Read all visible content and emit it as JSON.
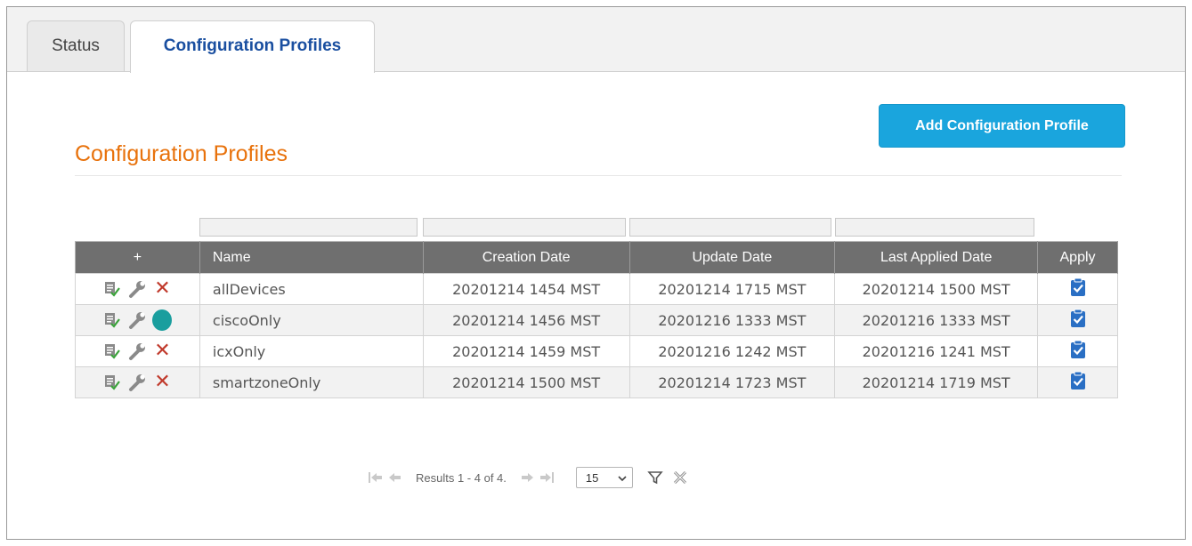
{
  "tabs": [
    {
      "label": "Status"
    },
    {
      "label": "Configuration Profiles"
    }
  ],
  "section": {
    "title": "Configuration Profiles",
    "add_button": "Add Configuration Profile"
  },
  "table": {
    "headers": {
      "actions": "+",
      "name": "Name",
      "creation": "Creation Date",
      "update": "Update Date",
      "last_applied": "Last Applied Date",
      "apply": "Apply"
    },
    "rows": [
      {
        "name": "allDevices",
        "creation": "20201214 1454 MST",
        "update": "20201214 1715 MST",
        "last_applied": "20201214 1500 MST",
        "status_icon": "delete-x-icon"
      },
      {
        "name": "ciscoOnly",
        "creation": "20201214 1456 MST",
        "update": "20201216 1333 MST",
        "last_applied": "20201216 1333 MST",
        "status_icon": "status-dot-icon"
      },
      {
        "name": "icxOnly",
        "creation": "20201214 1459 MST",
        "update": "20201216 1242 MST",
        "last_applied": "20201216 1241 MST",
        "status_icon": "delete-x-icon"
      },
      {
        "name": "smartzoneOnly",
        "creation": "20201214 1500 MST",
        "update": "20201214 1723 MST",
        "last_applied": "20201214 1719 MST",
        "status_icon": "delete-x-icon"
      }
    ]
  },
  "pager": {
    "results_text": "Results 1 - 4 of 4.",
    "page_size": "15"
  },
  "colors": {
    "accent_orange": "#e8720c",
    "button_blue": "#1aa5dd",
    "header_gray": "#6f6f6f",
    "status_teal": "#1a9e9e",
    "delete_red": "#c0392b"
  }
}
